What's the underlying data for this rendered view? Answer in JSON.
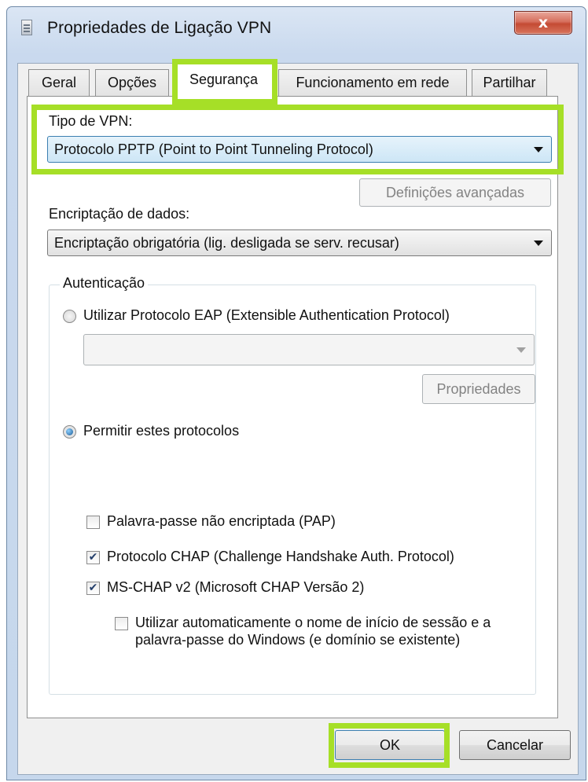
{
  "window": {
    "title": "Propriedades de Ligação VPN",
    "close_glyph": "x"
  },
  "tabs": [
    {
      "label": "Geral",
      "active": false
    },
    {
      "label": "Opções",
      "active": false
    },
    {
      "label": "Segurança",
      "active": true
    },
    {
      "label": "Funcionamento em rede",
      "active": false
    },
    {
      "label": "Partilhar",
      "active": false
    }
  ],
  "vpn_type": {
    "label": "Tipo de VPN:",
    "value": "Protocolo PPTP (Point to Point Tunneling Protocol)"
  },
  "advanced_button": "Definições avançadas",
  "encryption": {
    "label": "Encriptação de dados:",
    "value": "Encriptação obrigatória (lig. desligada se serv. recusar)"
  },
  "authentication": {
    "legend": "Autenticação",
    "eap_radio": {
      "label": "Utilizar Protocolo EAP (Extensible Authentication Protocol)",
      "checked": false
    },
    "eap_combo_value": "",
    "properties_button": "Propriedades",
    "allow_radio": {
      "label": "Permitir estes protocolos",
      "checked": true
    },
    "protocols": [
      {
        "label": "Palavra-passe não encriptada (PAP)",
        "checked": false
      },
      {
        "label": "Protocolo CHAP (Challenge Handshake Auth. Protocol)",
        "checked": true
      },
      {
        "label": "MS-CHAP v2 (Microsoft CHAP Versão 2)",
        "checked": true
      }
    ],
    "auto_logon": {
      "label": "Utilizar automaticamente o nome de início de sessão e a palavra-passe do Windows (e domínio se existente)",
      "checked": false
    }
  },
  "footer": {
    "ok": "OK",
    "cancel": "Cancelar"
  },
  "colors": {
    "highlight": "#a6df27",
    "close_button": "#c44a33",
    "selected_combo": "#cde6f6"
  }
}
